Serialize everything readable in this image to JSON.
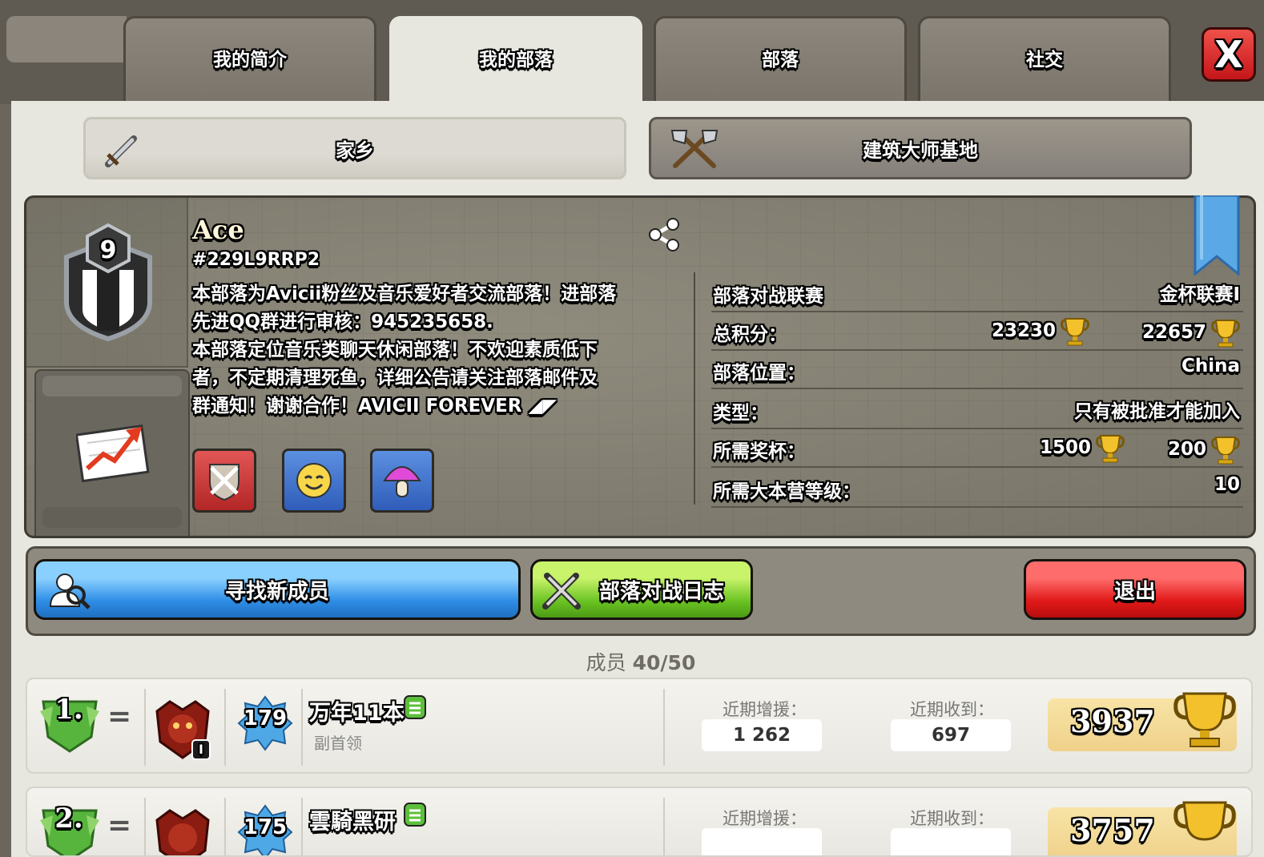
{
  "tabs": [
    "我的简介",
    "我的部落",
    "部落",
    "社交"
  ],
  "close_label": "X",
  "segments": {
    "home": "家乡",
    "builder": "建筑大师基地"
  },
  "clan": {
    "name": "Ace",
    "tag": "#229L9RRP2",
    "level": "9",
    "description_lines": [
      "本部落为Avicii粉丝及音乐爱好者交流部落！进部落",
      "先进QQ群进行审核：945235658.",
      "本部落定位音乐类聊天休闲部落！不欢迎素质低下",
      "者，不定期清理死鱼，详细公告请关注部落邮件及",
      "群通知！谢谢合作！AVICII FOREVER ◢◤"
    ],
    "stats": {
      "war_league_label": "部落对战联赛",
      "war_league_value": "金杯联赛I",
      "total_points_label": "总积分：",
      "total_points_home": "23230",
      "total_points_builder": "22657",
      "location_label": "部落位置：",
      "location_value": "China",
      "type_label": "类型：",
      "type_value": "只有被批准才能加入",
      "required_trophies_label": "所需奖杯：",
      "required_trophies_home": "1500",
      "required_trophies_builder": "200",
      "required_th_label": "所需大本营等级：",
      "required_th_value": "10"
    }
  },
  "actions": {
    "find": "寻找新成员",
    "war_log": "部落对战日志",
    "leave": "退出"
  },
  "members_label": "成员",
  "members_count": "40/50",
  "members": [
    {
      "rank": "1.",
      "name": "万年11本",
      "role": "副首领",
      "level": "179",
      "league_level": "I",
      "donated_label": "近期增援：",
      "donated": "1 262",
      "received_label": "近期收到：",
      "received": "697",
      "trophies": "3937"
    },
    {
      "rank": "2.",
      "name": "雲騎黑研",
      "level": "175",
      "donated_label": "近期增援：",
      "received_label": "近期收到：",
      "trophies": "3757"
    }
  ],
  "colors": {
    "accent_blue": "#2f8ee6",
    "accent_green": "#6cc424",
    "accent_red": "#e11a1a",
    "trophy_gold": "#f3c12b"
  },
  "icons": [
    "sword-icon",
    "crossed-axes-icon",
    "share-icon",
    "clan-badge-icon",
    "stats-chart-icon",
    "war-perk-icon",
    "smile-perk-icon",
    "mushroom-perk-icon",
    "trophy-icon",
    "search-user-icon",
    "crossed-swords-icon",
    "league-badge-icon",
    "level-star-icon",
    "list-icon"
  ]
}
